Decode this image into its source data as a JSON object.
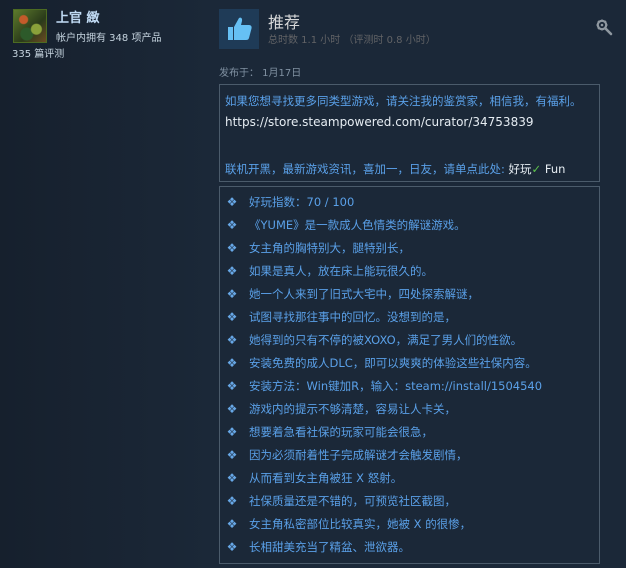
{
  "profile": {
    "username": "上官 緻",
    "owned_text": "帐户内拥有 348 项产品",
    "reviews_text": "335 篇评测"
  },
  "review": {
    "verdict": "推荐",
    "playtime": "总时数 1.1 小时 （评测时 0.8 小时）",
    "posted": "发布于： 1月17日",
    "thumb_icon": "thumbs-up-icon",
    "settings_icon": "gear-icon"
  },
  "box1": {
    "line1": "如果您想寻找更多同类型游戏，请关注我的鉴赏家，相信我，有福利。",
    "url": "https://store.steampowered.com/curator/34753839",
    "line3_prefix": "联机开黑，最新游戏资讯，喜加一，日友，请单点此处:",
    "line3_link": "好玩",
    "line3_check": "✓",
    "line3_suffix": "Fun"
  },
  "bullets": [
    "好玩指数：70 / 100",
    "《YUME》是一款成人色情类的解谜游戏。",
    "女主角的胸特别大，腿特别长，",
    "如果是真人，放在床上能玩很久的。",
    "她一个人来到了旧式大宅中，四处探索解谜，",
    "试图寻找那往事中的回忆。没想到的是，",
    "她得到的只有不停的被XOXO，满足了男人们的性欲。",
    "安装免费的成人DLC，即可以爽爽的体验这些社保内容。",
    "安装方法：Win键加R，输入：steam://install/1504540",
    "游戏内的提示不够清楚，容易让人卡关，",
    "想要着急看社保的玩家可能会很急，",
    "因为必须耐着性子完成解谜才会触发剧情，",
    "从而看到女主角被狂 X 怒射。",
    "社保质量还是不错的，可预览社区截图，",
    "女主角私密部位比较真实，她被 X 的很惨，",
    "长相甜美充当了精盆、泄欲器。"
  ],
  "bullet_glyph": "❖"
}
